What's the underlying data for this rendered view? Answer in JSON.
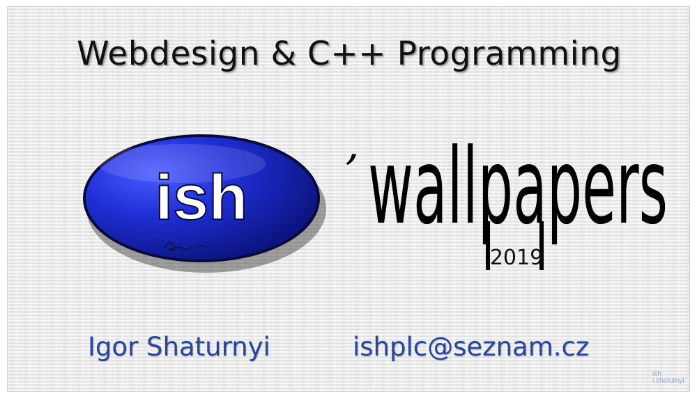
{
  "header": {
    "title": "Webdesign & C++ Programming"
  },
  "logo": {
    "text": "ish",
    "accent_color": "#1f2fd6"
  },
  "brand": {
    "apostrophe": "’",
    "word": "wallpapers",
    "year": "2019"
  },
  "contact": {
    "name": "Igor Shaturnyi",
    "email": "ishplc@seznam.cz",
    "text_color": "#27479c"
  },
  "watermark": {
    "line1": "ish",
    "line2": "i.shaturnyi"
  }
}
